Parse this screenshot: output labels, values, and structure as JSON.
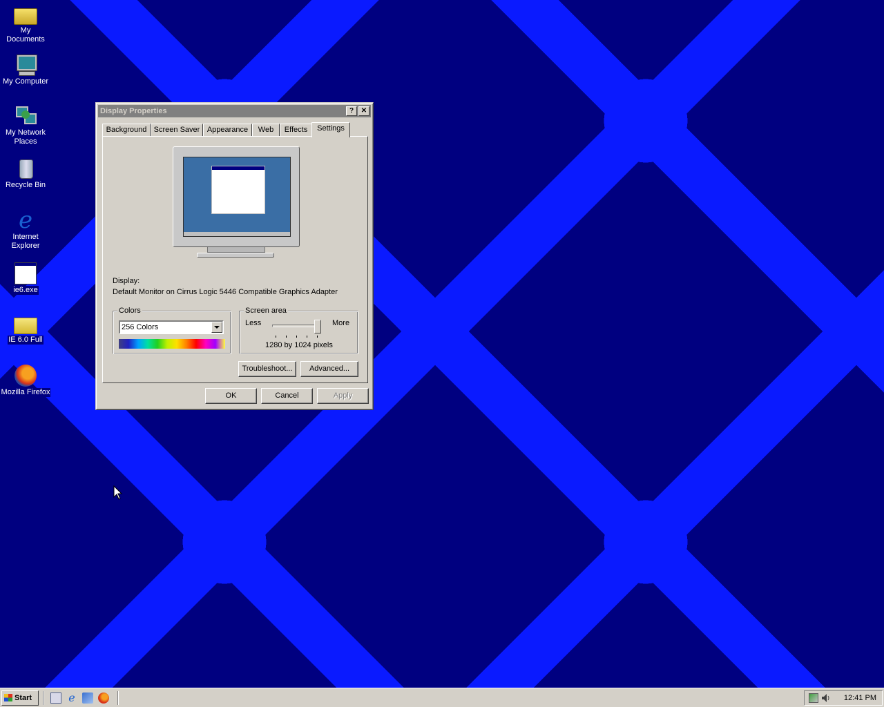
{
  "desktop": {
    "icons": [
      {
        "label": "My Documents",
        "icon": "my-documents-icon"
      },
      {
        "label": "My Computer",
        "icon": "my-computer-icon"
      },
      {
        "label": "My Network\nPlaces",
        "icon": "my-network-places-icon"
      },
      {
        "label": "Recycle Bin",
        "icon": "recycle-bin-icon"
      },
      {
        "label": "Internet\nExplorer",
        "icon": "internet-explorer-icon"
      },
      {
        "label": "ie6.exe",
        "icon": "exe-file-icon"
      },
      {
        "label": "IE 6.0 Full",
        "icon": "folder-icon"
      },
      {
        "label": "Mozilla Firefox",
        "icon": "firefox-icon"
      }
    ],
    "background_colors": {
      "dark": "#000080",
      "light": "#0a1aff"
    }
  },
  "window": {
    "title": "Display Properties",
    "help_glyph": "?",
    "close_glyph": "✕",
    "tabs": [
      "Background",
      "Screen Saver",
      "Appearance",
      "Web",
      "Effects",
      "Settings"
    ],
    "active_tab": "Settings",
    "display_label": "Display:",
    "display_value": "Default Monitor on Cirrus Logic 5446 Compatible Graphics Adapter",
    "colors": {
      "group_label": "Colors",
      "selected": "256 Colors"
    },
    "screen_area": {
      "group_label": "Screen area",
      "less": "Less",
      "more": "More",
      "value_text": "1280 by 1024 pixels",
      "slider_level": 1.0
    },
    "troubleshoot_label": "Troubleshoot...",
    "advanced_label": "Advanced...",
    "ok_label": "OK",
    "cancel_label": "Cancel",
    "apply_label": "Apply"
  },
  "taskbar": {
    "start_label": "Start",
    "quick_launch": [
      "show-desktop-icon",
      "internet-explorer-icon",
      "outlook-express-icon",
      "firefox-icon"
    ],
    "clock": "12:41 PM"
  }
}
